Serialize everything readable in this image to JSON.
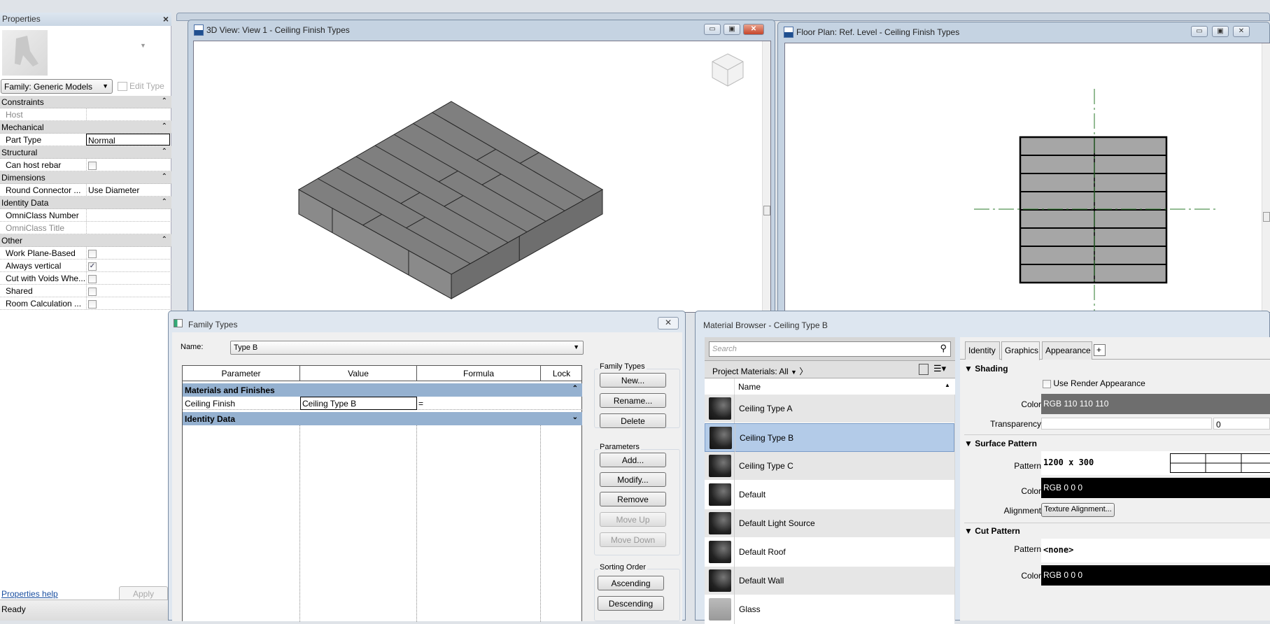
{
  "properties": {
    "title": "Properties",
    "close": "×",
    "family": "Family: Generic Models",
    "edit_type": "Edit Type",
    "rows": [
      {
        "type": "hdr",
        "label": "Constraints"
      },
      {
        "type": "row",
        "label": "Host",
        "value": "",
        "muted": true
      },
      {
        "type": "hdr",
        "label": "Mechanical"
      },
      {
        "type": "row",
        "label": "Part Type",
        "value": "Normal"
      },
      {
        "type": "hdr",
        "label": "Structural"
      },
      {
        "type": "check",
        "label": "Can host rebar",
        "checked": false
      },
      {
        "type": "hdr",
        "label": "Dimensions"
      },
      {
        "type": "row",
        "label": "Round Connector ...",
        "value": "Use Diameter"
      },
      {
        "type": "hdr",
        "label": "Identity Data"
      },
      {
        "type": "row",
        "label": "OmniClass Number",
        "value": ""
      },
      {
        "type": "row",
        "label": "OmniClass Title",
        "value": "",
        "muted": true
      },
      {
        "type": "hdr",
        "label": "Other"
      },
      {
        "type": "check",
        "label": "Work Plane-Based",
        "checked": false
      },
      {
        "type": "check",
        "label": "Always vertical",
        "checked": true
      },
      {
        "type": "check",
        "label": "Cut with Voids Whe...",
        "checked": false
      },
      {
        "type": "check",
        "label": "Shared",
        "checked": false
      },
      {
        "type": "check",
        "label": "Room Calculation ...",
        "checked": false
      }
    ],
    "help": "Properties help",
    "apply": "Apply"
  },
  "status": "Ready",
  "view3d": {
    "title": "3D View: View 1 - Ceiling Finish Types",
    "icon": "RVT"
  },
  "floorplan": {
    "title": "Floor Plan: Ref. Level - Ceiling Finish Types",
    "icon": "RVT",
    "rows": 8,
    "columns": 2
  },
  "family_types": {
    "title": "Family Types",
    "name_label": "Name:",
    "name_value": "Type B",
    "columns": [
      "Parameter",
      "Value",
      "Formula",
      "Lock"
    ],
    "sections": [
      {
        "label": "Materials and Finishes"
      },
      {
        "label": "Identity Data"
      }
    ],
    "param_row": {
      "parameter": "Ceiling Finish",
      "value": "Ceiling Type B",
      "formula": "="
    },
    "groups": {
      "family_types": "Family Types",
      "parameters": "Parameters",
      "sorting": "Sorting Order"
    },
    "buttons": {
      "new": "New...",
      "rename": "Rename...",
      "delete": "Delete",
      "add": "Add...",
      "modify": "Modify...",
      "remove": "Remove",
      "move_up": "Move Up",
      "move_down": "Move Down",
      "ascending": "Ascending",
      "descending": "Descending"
    }
  },
  "material_browser": {
    "title": "Material Browser - Ceiling Type B",
    "search_placeholder": "Search",
    "filter": "Project Materials: All",
    "name_header": "Name",
    "materials": [
      "Ceiling Type A",
      "Ceiling Type B",
      "Ceiling Type C",
      "Default",
      "Default Light Source",
      "Default Roof",
      "Default Wall",
      "Glass"
    ],
    "selected": "Ceiling Type B",
    "tabs": [
      "Identity",
      "Graphics",
      "Appearance",
      "+"
    ],
    "active_tab": "Graphics",
    "shading": {
      "header": "Shading",
      "use_render": "Use Render Appearance",
      "color_label": "Color",
      "color": "RGB 110 110 110",
      "color_hex": "#6e6e6e",
      "transparency_label": "Transparency",
      "transparency": "0"
    },
    "surface": {
      "header": "Surface Pattern",
      "pattern_label": "Pattern",
      "pattern": "1200 x 300",
      "color_label": "Color",
      "color": "RGB 0 0 0",
      "alignment_label": "Alignment",
      "alignment_btn": "Texture Alignment..."
    },
    "cut": {
      "header": "Cut Pattern",
      "pattern_label": "Pattern",
      "pattern": "<none>",
      "color_label": "Color",
      "color": "RGB 0 0 0"
    }
  }
}
